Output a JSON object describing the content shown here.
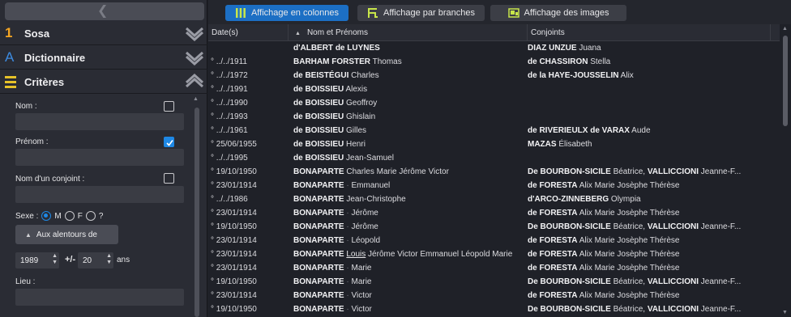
{
  "toolbar": {
    "view_columns": "Affichage en colonnes",
    "view_branches": "Affichage par branches",
    "view_images": "Affichage des images"
  },
  "sidebar": {
    "sosa_icon": "1",
    "sosa": "Sosa",
    "dict_icon": "A",
    "dictionnaire": "Dictionnaire",
    "criteres": "Critères",
    "nom_label": "Nom :",
    "prenom_label": "Prénom :",
    "conjoint_label": "Nom d'un conjoint :",
    "sexe_label": "Sexe :",
    "sexe_m": "M",
    "sexe_f": "F",
    "sexe_q": "?",
    "around_button": "Aux alentours de",
    "year_value": "1989",
    "plusminus": "+/-",
    "range_value": "20",
    "ans_label": "ans",
    "lieu_label": "Lieu :",
    "nom_checked": false,
    "prenom_checked": true,
    "conjoint_checked": false,
    "sexe_selected": "M"
  },
  "table": {
    "col_date": "Date(s)",
    "col_name": "Nom et Prénoms",
    "col_conj": "Conjoints",
    "rows": [
      {
        "date": "",
        "name": [
          [
            "b",
            "d'ALBERT de LUYNES"
          ]
        ],
        "conj": [
          [
            "b",
            "DIAZ UNZUE"
          ],
          [
            "n",
            " Juana"
          ]
        ]
      },
      {
        "date": "° ../../1911",
        "name": [
          [
            "b",
            "BARHAM FORSTER"
          ],
          [
            "n",
            " Thomas"
          ]
        ],
        "conj": [
          [
            "b",
            "de CHASSIRON"
          ],
          [
            "n",
            " Stella"
          ]
        ]
      },
      {
        "date": "° ../../1972",
        "name": [
          [
            "b",
            "de BEISTÉGUI"
          ],
          [
            "n",
            " Charles"
          ]
        ],
        "conj": [
          [
            "b",
            "de la HAYE-JOUSSELIN"
          ],
          [
            "n",
            " Alix"
          ]
        ]
      },
      {
        "date": "° ../../1991",
        "name": [
          [
            "b",
            "de BOISSIEU"
          ],
          [
            "n",
            " Alexis"
          ]
        ],
        "conj": []
      },
      {
        "date": "° ../../1990",
        "name": [
          [
            "b",
            "de BOISSIEU"
          ],
          [
            "n",
            " Geoffroy"
          ]
        ],
        "conj": []
      },
      {
        "date": "° ../../1993",
        "name": [
          [
            "b",
            "de BOISSIEU"
          ],
          [
            "n",
            " Ghislain"
          ]
        ],
        "conj": []
      },
      {
        "date": "° ../../1961",
        "name": [
          [
            "b",
            "de BOISSIEU"
          ],
          [
            "n",
            " Gilles"
          ]
        ],
        "conj": [
          [
            "b",
            "de RIVERIEULX de VARAX"
          ],
          [
            "n",
            " Aude"
          ]
        ]
      },
      {
        "date": "° 25/06/1955",
        "name": [
          [
            "b",
            "de BOISSIEU"
          ],
          [
            "n",
            " Henri"
          ]
        ],
        "conj": [
          [
            "b",
            "MAZAS"
          ],
          [
            "n",
            " Élisabeth"
          ]
        ]
      },
      {
        "date": "° ../../1995",
        "name": [
          [
            "b",
            "de BOISSIEU"
          ],
          [
            "n",
            " Jean-Samuel"
          ]
        ],
        "conj": []
      },
      {
        "date": "° 19/10/1950",
        "name": [
          [
            "b",
            "BONAPARTE"
          ],
          [
            "n",
            " Charles Marie Jérôme Victor"
          ]
        ],
        "conj": [
          [
            "b",
            "De BOURBON-SICILE"
          ],
          [
            "n",
            " Béatrice, "
          ],
          [
            "b",
            "VALLICCIONI"
          ],
          [
            "n",
            " Jeanne-F..."
          ]
        ]
      },
      {
        "date": "° 23/01/1914",
        "name": [
          [
            "b",
            "BONAPARTE"
          ],
          [
            "d",
            " · "
          ],
          [
            "n",
            "Emmanuel"
          ]
        ],
        "conj": [
          [
            "b",
            "de FORESTA"
          ],
          [
            "n",
            " Alix Marie Josèphe Thérèse"
          ]
        ]
      },
      {
        "date": "° ../../1986",
        "name": [
          [
            "b",
            "BONAPARTE"
          ],
          [
            "n",
            " Jean-Christophe"
          ]
        ],
        "conj": [
          [
            "b",
            "d'ARCO-ZINNEBERG"
          ],
          [
            "n",
            " Olympia"
          ]
        ]
      },
      {
        "date": "° 23/01/1914",
        "name": [
          [
            "b",
            "BONAPARTE"
          ],
          [
            "d",
            " · "
          ],
          [
            "n",
            "Jérôme"
          ]
        ],
        "conj": [
          [
            "b",
            "de FORESTA"
          ],
          [
            "n",
            " Alix Marie Josèphe Thérèse"
          ]
        ]
      },
      {
        "date": "° 19/10/1950",
        "name": [
          [
            "b",
            "BONAPARTE"
          ],
          [
            "d",
            " · "
          ],
          [
            "n",
            "Jérôme"
          ]
        ],
        "conj": [
          [
            "b",
            "De BOURBON-SICILE"
          ],
          [
            "n",
            " Béatrice, "
          ],
          [
            "b",
            "VALLICCIONI"
          ],
          [
            "n",
            " Jeanne-F..."
          ]
        ]
      },
      {
        "date": "° 23/01/1914",
        "name": [
          [
            "b",
            "BONAPARTE"
          ],
          [
            "d",
            " · "
          ],
          [
            "n",
            "Léopold"
          ]
        ],
        "conj": [
          [
            "b",
            "de FORESTA"
          ],
          [
            "n",
            " Alix Marie Josèphe Thérèse"
          ]
        ]
      },
      {
        "date": "° 23/01/1914",
        "name": [
          [
            "b",
            "BONAPARTE"
          ],
          [
            "n",
            " "
          ],
          [
            "u",
            "Louis"
          ],
          [
            "n",
            " Jérôme Victor Emmanuel Léopold Marie"
          ]
        ],
        "conj": [
          [
            "b",
            "de FORESTA"
          ],
          [
            "n",
            " Alix Marie Josèphe Thérèse"
          ]
        ]
      },
      {
        "date": "° 23/01/1914",
        "name": [
          [
            "b",
            "BONAPARTE"
          ],
          [
            "d",
            " · "
          ],
          [
            "n",
            "Marie"
          ]
        ],
        "conj": [
          [
            "b",
            "de FORESTA"
          ],
          [
            "n",
            " Alix Marie Josèphe Thérèse"
          ]
        ]
      },
      {
        "date": "° 19/10/1950",
        "name": [
          [
            "b",
            "BONAPARTE"
          ],
          [
            "d",
            " · "
          ],
          [
            "n",
            "Marie"
          ]
        ],
        "conj": [
          [
            "b",
            "De BOURBON-SICILE"
          ],
          [
            "n",
            " Béatrice, "
          ],
          [
            "b",
            "VALLICCIONI"
          ],
          [
            "n",
            " Jeanne-F..."
          ]
        ]
      },
      {
        "date": "° 23/01/1914",
        "name": [
          [
            "b",
            "BONAPARTE"
          ],
          [
            "d",
            " · "
          ],
          [
            "n",
            "Victor"
          ]
        ],
        "conj": [
          [
            "b",
            "de FORESTA"
          ],
          [
            "n",
            " Alix Marie Josèphe Thérèse"
          ]
        ]
      },
      {
        "date": "° 19/10/1950",
        "name": [
          [
            "b",
            "BONAPARTE"
          ],
          [
            "d",
            " · "
          ],
          [
            "n",
            "Victor"
          ]
        ],
        "conj": [
          [
            "b",
            "De BOURBON-SICILE"
          ],
          [
            "n",
            " Béatrice, "
          ],
          [
            "b",
            "VALLICCIONI"
          ],
          [
            "n",
            " Jeanne-F..."
          ]
        ]
      }
    ]
  },
  "colors": {
    "accent": "#1c6fc4",
    "checkbox_on": "#1e88e5",
    "sosa_icon": "#f5a623",
    "dict_icon": "#3d8be0",
    "crit_icon": "#e6c229"
  }
}
